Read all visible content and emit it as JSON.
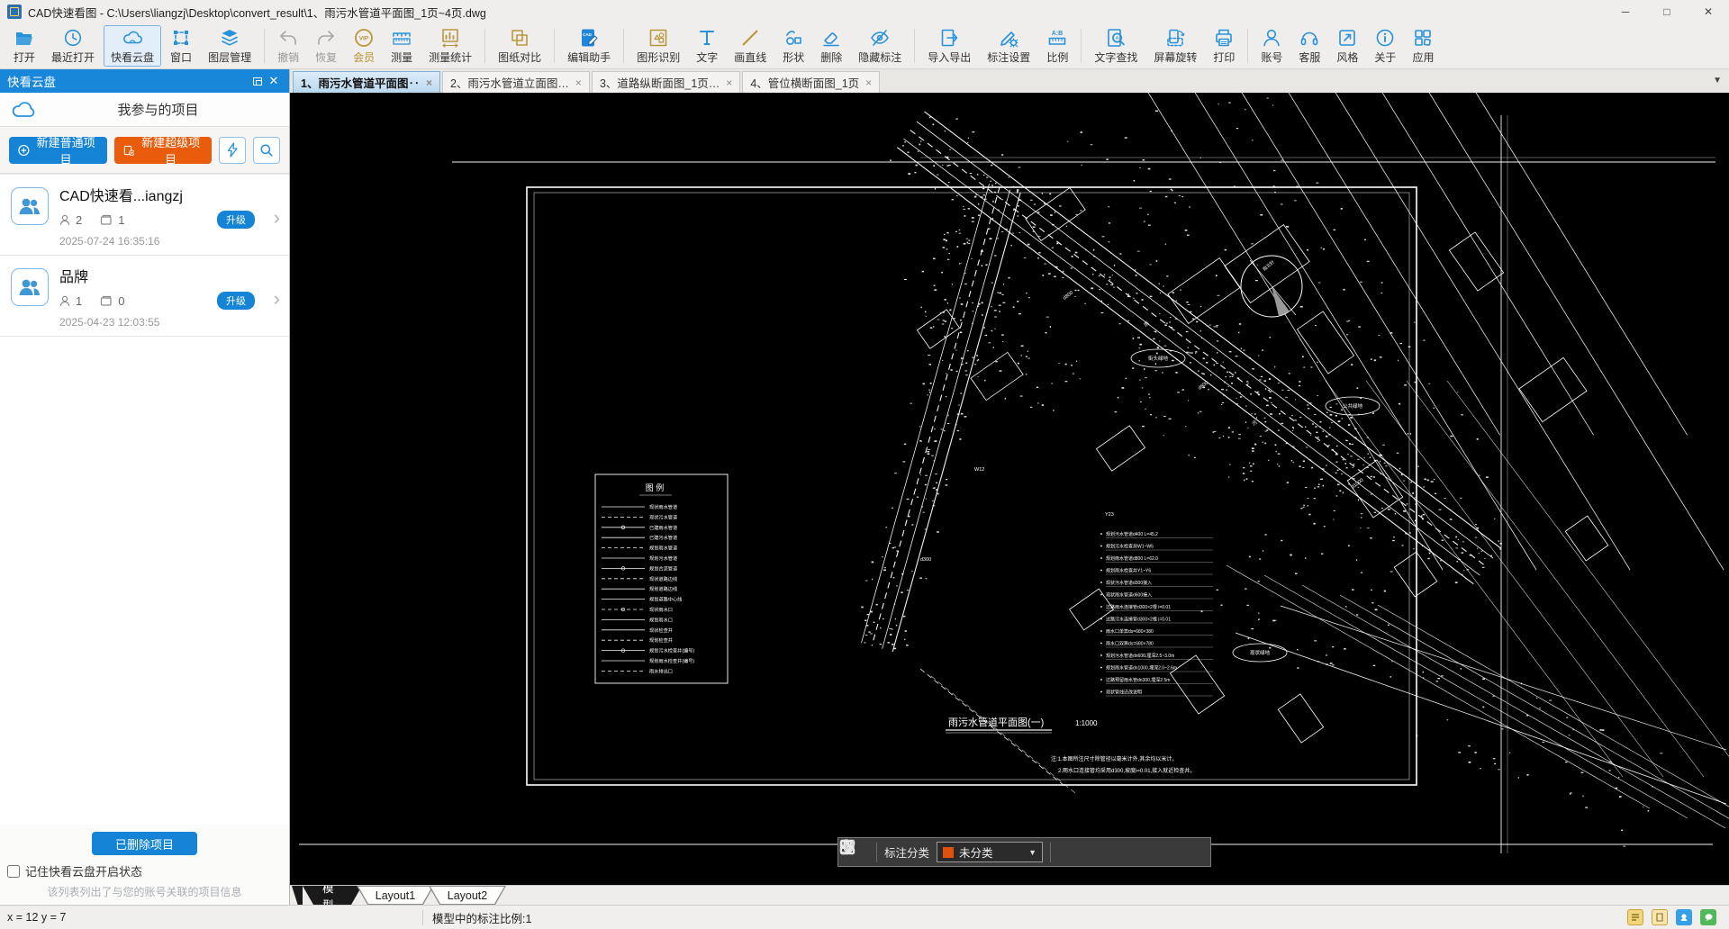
{
  "window": {
    "title": "CAD快速看图 - C:\\Users\\liangzj\\Desktop\\convert_result\\1、雨污水管道平面图_1页~4页.dwg",
    "minimize": "─",
    "maximize": "□",
    "close": "✕"
  },
  "toolbar": {
    "items": [
      {
        "name": "open",
        "label": "打开",
        "style": "blue"
      },
      {
        "name": "recent",
        "label": "最近打开",
        "style": "blue"
      },
      {
        "name": "cloud",
        "label": "快看云盘",
        "style": "blue",
        "active": true
      },
      {
        "name": "window",
        "label": "窗口",
        "style": "blue"
      },
      {
        "name": "layers",
        "label": "图层管理",
        "style": "blue"
      },
      {
        "type": "sep"
      },
      {
        "name": "undo",
        "label": "撤销",
        "style": "gray",
        "disabled": true
      },
      {
        "name": "redo",
        "label": "恢复",
        "style": "gray",
        "disabled": true
      },
      {
        "name": "vip",
        "label": "会员",
        "style": "gold",
        "goldLabel": true
      },
      {
        "name": "measure",
        "label": "测量",
        "style": "blue"
      },
      {
        "name": "measure-stats",
        "label": "测量统计",
        "style": "gold"
      },
      {
        "type": "sep"
      },
      {
        "name": "compare",
        "label": "图纸对比",
        "style": "gold"
      },
      {
        "type": "sep"
      },
      {
        "name": "edit-assistant",
        "label": "编辑助手",
        "style": "blue"
      },
      {
        "type": "sep"
      },
      {
        "name": "shape-recognize",
        "label": "图形识别",
        "style": "gold"
      },
      {
        "name": "text",
        "label": "文字",
        "style": "blue"
      },
      {
        "name": "draw-line",
        "label": "画直线",
        "style": "gold"
      },
      {
        "name": "shapes",
        "label": "形状",
        "style": "blue"
      },
      {
        "name": "delete",
        "label": "删除",
        "style": "blue"
      },
      {
        "name": "hide-annotation",
        "label": "隐藏标注",
        "style": "blue"
      },
      {
        "type": "sep"
      },
      {
        "name": "import-export",
        "label": "导入导出",
        "style": "blue"
      },
      {
        "name": "annotation-settings",
        "label": "标注设置",
        "style": "blue"
      },
      {
        "name": "ratio",
        "label": "比例",
        "style": "blue"
      },
      {
        "type": "sep"
      },
      {
        "name": "find-text",
        "label": "文字查找",
        "style": "blue"
      },
      {
        "name": "rotate-screen",
        "label": "屏幕旋转",
        "style": "blue"
      },
      {
        "name": "print",
        "label": "打印",
        "style": "blue"
      },
      {
        "type": "sep"
      },
      {
        "name": "account",
        "label": "账号",
        "style": "blue"
      },
      {
        "name": "support",
        "label": "客服",
        "style": "blue"
      },
      {
        "name": "style",
        "label": "风格",
        "style": "blue"
      },
      {
        "name": "about",
        "label": "关于",
        "style": "blue"
      },
      {
        "name": "apps",
        "label": "应用",
        "style": "blue"
      }
    ],
    "colors": {
      "blue": "#2792dc",
      "gold": "#b9963e",
      "gray": "#a7a7a7"
    }
  },
  "cloud_panel": {
    "title": "快看云盘",
    "section_title": "我参与的项目",
    "new_normal": "新建普通项目",
    "new_super": "新建超级项目",
    "projects": [
      {
        "name": "CAD快速看...iangzj",
        "members": "2",
        "files": "1",
        "badge": "升级",
        "date": "2025-07-24 16:35:16"
      },
      {
        "name": "品牌",
        "members": "1",
        "files": "0",
        "badge": "升级",
        "date": "2025-04-23 12:03:55"
      }
    ],
    "deleted_button": "已删除项目",
    "remember_label": "记住快看云盘开启状态",
    "hint": "该列表列出了与您的账号关联的项目信息"
  },
  "tabs": [
    {
      "label": "1、雨污水管道平面图‥",
      "close": "×",
      "active": true
    },
    {
      "label": "2、雨污水管道立面图…",
      "close": "×",
      "active": false
    },
    {
      "label": "3、道路纵断面图_1页…",
      "close": "×",
      "active": false
    },
    {
      "label": "4、管位横断面图_1页",
      "close": "×",
      "active": false
    }
  ],
  "tab_overflow": "▼",
  "drawing": {
    "title": "雨污水管道平面图(一)",
    "scale": "1:1000",
    "legend_title": "图 例",
    "legend_items": [
      "现状雨水管道",
      "现状污水管道",
      "已建雨水管道",
      "已建污水管道",
      "规划雨水管道",
      "规划污水管道",
      "规划合流管道",
      "现状道路边线",
      "规划道路边线",
      "规划道路中心线",
      "现状雨水口",
      "规划雨水口",
      "现状检查井",
      "规划检查井",
      "规划污水检查井(编号)",
      "规划雨水检查井(编号)",
      "雨水排出口"
    ],
    "table_rows": [
      "规划污水管道d400 L=45.2",
      "规划污水检查井W1~W5",
      "规划雨水管道d800 L=62.0",
      "规划雨水检查井Y1~Y6",
      "现状污水管道d300接入",
      "现状雨水管道d600接入",
      "过路雨水连接管d300×2根 i=0.01",
      "过路污水连接管d300×2根 i=0.01",
      "雨水口单箅ds=680×380",
      "雨水口双箅ds=680×780",
      "规划污水管道dn600,埋深2.5~3.0m",
      "规划雨水管道dn1000,埋深2.0~2.6m",
      "过路预留雨水管dn300,埋深2.5m",
      "现状管线迁改说明"
    ],
    "notes": [
      "注:1.本图所注尺寸除管径以毫米计外,其余均以米计。",
      "2.雨水口连接管均采用d300,坡度i=0.01,接入就近检查井。"
    ],
    "ellipse_labels": [
      "街头绿地",
      "公共绿地",
      "现状绿地"
    ]
  },
  "annotation_bar": {
    "category_label": "标注分类",
    "selected": "未分类",
    "caret": "▼",
    "swatch_color": "#e2500e"
  },
  "layout_tabs": [
    "模型",
    "Layout1",
    "Layout2"
  ],
  "status_bar": {
    "coords": "x = 12 y = 7",
    "scale_text": "模型中的标注比例:1"
  }
}
